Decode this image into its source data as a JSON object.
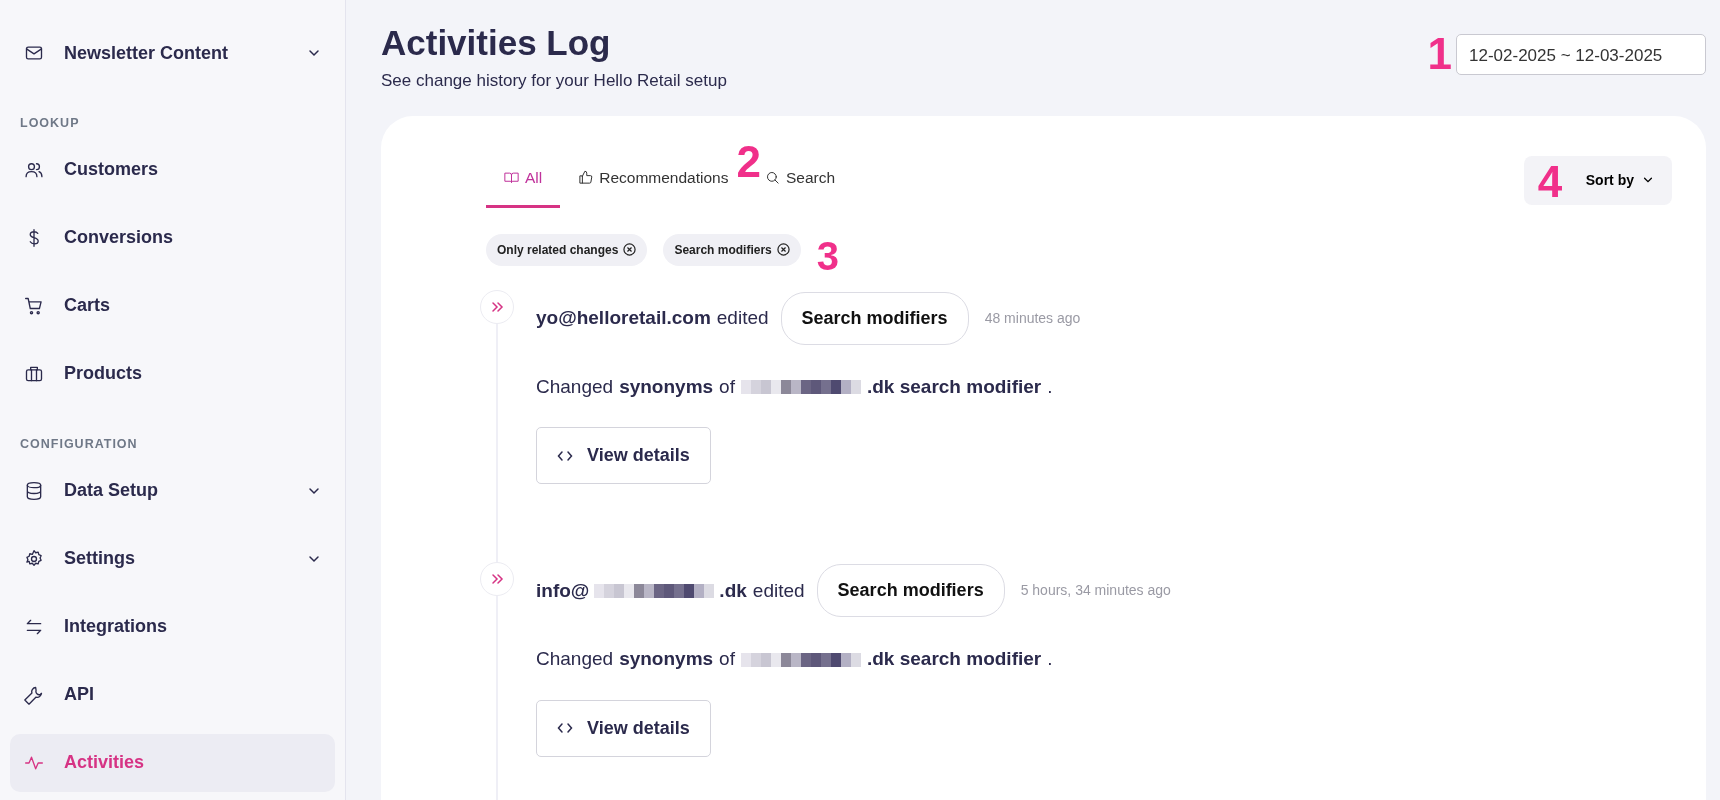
{
  "sidebar": {
    "items": [
      {
        "kind": "item",
        "label": "Newsletter Content",
        "expandable": true,
        "selected": false
      },
      {
        "kind": "section",
        "label": "LOOKUP"
      },
      {
        "kind": "item",
        "label": "Customers",
        "expandable": false,
        "selected": false
      },
      {
        "kind": "item",
        "label": "Conversions",
        "expandable": false,
        "selected": false
      },
      {
        "kind": "item",
        "label": "Carts",
        "expandable": false,
        "selected": false
      },
      {
        "kind": "item",
        "label": "Products",
        "expandable": false,
        "selected": false
      },
      {
        "kind": "section",
        "label": "CONFIGURATION"
      },
      {
        "kind": "item",
        "label": "Data Setup",
        "expandable": true,
        "selected": false
      },
      {
        "kind": "item",
        "label": "Settings",
        "expandable": true,
        "selected": false
      },
      {
        "kind": "item",
        "label": "Integrations",
        "expandable": false,
        "selected": false
      },
      {
        "kind": "item",
        "label": "API",
        "expandable": false,
        "selected": false
      },
      {
        "kind": "item",
        "label": "Activities",
        "expandable": false,
        "selected": true
      }
    ]
  },
  "header": {
    "title": "Activities Log",
    "subtitle": "See change history for your Hello Retail setup",
    "date_range": {
      "value": "12-02-2025 ~ 12-03-2025",
      "callout": "1"
    }
  },
  "tabs": [
    {
      "label": "All",
      "selected": true
    },
    {
      "label": "Recommendations",
      "selected": false
    },
    {
      "label": "Search",
      "selected": false
    }
  ],
  "tabs_callout": "2",
  "filters": [
    {
      "label": "Only related changes"
    },
    {
      "label": "Search modifiers"
    }
  ],
  "filters_callout": "3",
  "sort": {
    "label": "Sort by",
    "callout": "4"
  },
  "activities": [
    {
      "actor": [
        {
          "kind": "text",
          "text": "yo@helloretail.com"
        }
      ],
      "verb": "edited",
      "target": "Search modifiers",
      "time": "48 minutes ago",
      "description": [
        {
          "kind": "plain",
          "text": "Changed"
        },
        {
          "kind": "bold",
          "text": "synonyms"
        },
        {
          "kind": "plain",
          "text": "of"
        },
        {
          "kind": "redaction"
        },
        {
          "kind": "bold",
          "text": ".dk search modifier"
        },
        {
          "kind": "plain",
          "text": "."
        }
      ],
      "button": "View details"
    },
    {
      "actor": [
        {
          "kind": "text",
          "text": "info@"
        },
        {
          "kind": "redaction"
        },
        {
          "kind": "text",
          "text": ".dk"
        }
      ],
      "verb": "edited",
      "target": "Search modifiers",
      "time": "5 hours, 34 minutes ago",
      "description": [
        {
          "kind": "plain",
          "text": "Changed"
        },
        {
          "kind": "bold",
          "text": "synonyms"
        },
        {
          "kind": "plain",
          "text": "of"
        },
        {
          "kind": "redaction"
        },
        {
          "kind": "bold",
          "text": ".dk search modifier"
        },
        {
          "kind": "plain",
          "text": "."
        }
      ],
      "button": "View details"
    }
  ]
}
